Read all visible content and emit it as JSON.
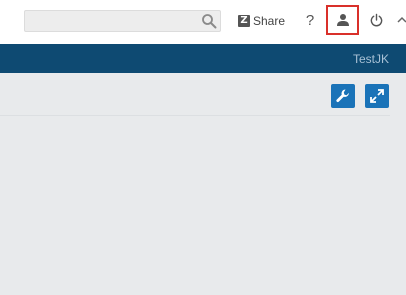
{
  "header": {
    "search": {
      "placeholder": "",
      "value": "",
      "icon": "search-icon"
    },
    "share": {
      "logo_letter": "Z",
      "label": "Share"
    },
    "help": {
      "label": "?"
    },
    "user": {
      "icon": "user-icon",
      "highlight_color": "#d9302a"
    },
    "power": {
      "icon": "power-icon"
    }
  },
  "navbar": {
    "workspace_name": "TestJK",
    "color": "#0e4a72"
  },
  "content": {
    "tools": [
      {
        "icon": "wrench-icon"
      },
      {
        "icon": "expand-icon"
      }
    ],
    "accent_color": "#1a73b8"
  }
}
